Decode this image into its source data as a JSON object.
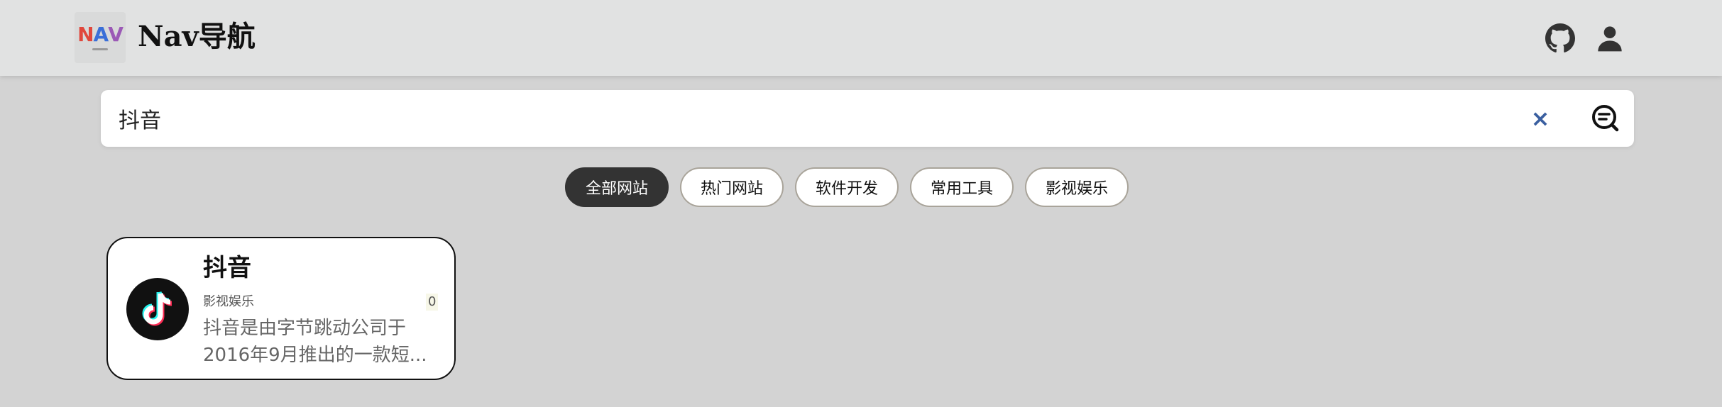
{
  "header": {
    "title": "Nav导航",
    "logo": {
      "letters": [
        "N",
        "A",
        "V"
      ],
      "colors": [
        "#e0473c",
        "#3a6fd8",
        "#9b59b6"
      ]
    },
    "github_icon": "github-icon",
    "user_icon": "user-icon"
  },
  "search": {
    "value": "抖音",
    "clear_label": "×",
    "submit_icon": "search-list-icon"
  },
  "tabs": [
    {
      "label": "全部网站",
      "active": true
    },
    {
      "label": "热门网站",
      "active": false
    },
    {
      "label": "软件开发",
      "active": false
    },
    {
      "label": "常用工具",
      "active": false
    },
    {
      "label": "影视娱乐",
      "active": false
    }
  ],
  "results": [
    {
      "title": "抖音",
      "category": "影视娱乐",
      "count": "0",
      "description_line1": "抖音是由字节跳动公司于",
      "description_line2": "2016年9月推出的一款短...",
      "icon": "tiktok-icon"
    }
  ],
  "colors": {
    "background": "#d3d3d3",
    "header": "#e1e2e2",
    "active_tab": "#333333",
    "clear_icon": "#3a5fa0"
  }
}
